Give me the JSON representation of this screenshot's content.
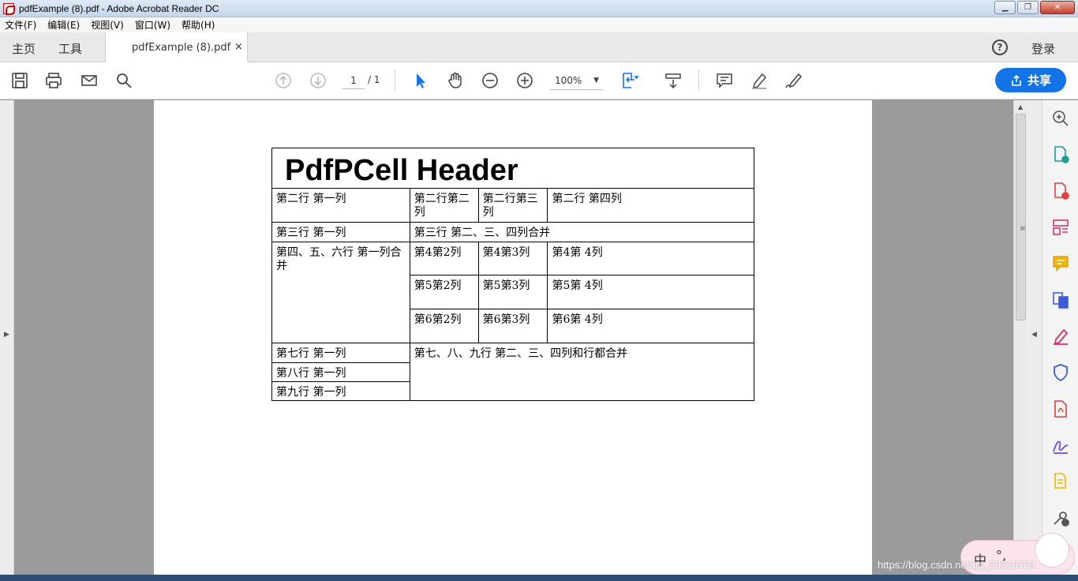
{
  "window": {
    "title": "pdfExample (8).pdf - Adobe Acrobat Reader DC",
    "minimize": "▁",
    "maximize": "❐",
    "close": "✕"
  },
  "menubar": {
    "items": [
      "文件(F)",
      "编辑(E)",
      "视图(V)",
      "窗口(W)",
      "帮助(H)"
    ]
  },
  "tabs": {
    "home": "主页",
    "tools": "工具",
    "document": "pdfExample (8).pdf",
    "close": "×"
  },
  "account": {
    "help": "?",
    "signin": "登录"
  },
  "toolbar": {
    "page_current": "1",
    "page_total": "/ 1",
    "zoom": "100%",
    "zoom_caret": "▼",
    "share_label": "共享"
  },
  "document": {
    "header": "PdfPCell Header",
    "rows": {
      "r2c1": "第二行 第一列",
      "r2c2": "第二行第二列",
      "r2c3": "第二行第三列",
      "r2c4": "第二行 第四列",
      "r3c1": "第三行 第一列",
      "r3c2": "第三行 第二、三、四列合并",
      "r4c1": "第四、五、六行 第一列合并",
      "r4c2": "第4第2列",
      "r4c3": "第4第3列",
      "r4c4": "第4第 4列",
      "r5c2": "第5第2列",
      "r5c3": "第5第3列",
      "r5c4": "第5第 4列",
      "r6c2": "第6第2列",
      "r6c3": "第6第3列",
      "r6c4": "第6第 4列",
      "r7c1": "第七行 第一列",
      "r7c2": "第七、八、九行 第二、三、四列和行都合并",
      "r8c1": "第八行 第一列",
      "r9c1": "第九行 第一列"
    }
  },
  "ime": {
    "mode": "中",
    "punct": "°,",
    "watermark": "https://blog.csdn.net/qq_30316709"
  },
  "colors": {
    "accent": "#1473e6",
    "page_bg": "#9b9b9b"
  }
}
